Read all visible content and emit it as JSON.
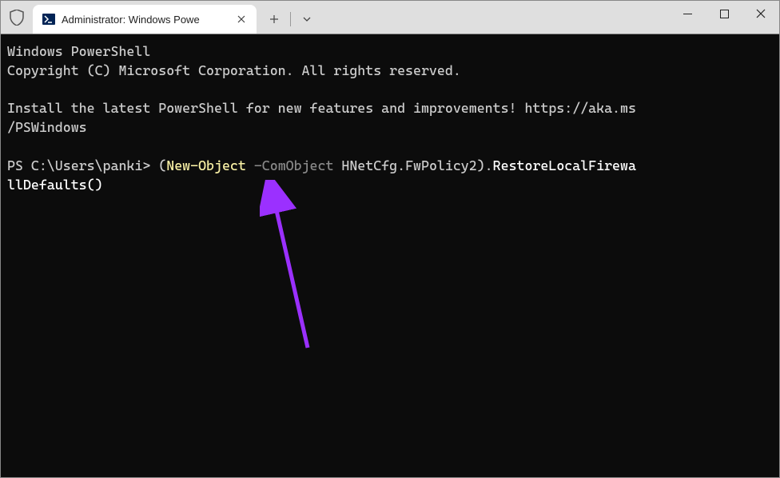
{
  "window": {
    "tab_title": "Administrator: Windows Powe"
  },
  "terminal": {
    "line1": "Windows PowerShell",
    "line2": "Copyright (C) Microsoft Corporation. All rights reserved.",
    "line3_a": "Install the latest PowerShell for new features and improvements! https://aka.ms",
    "line3_b": "/PSWindows",
    "prompt": "PS C:\\Users\\panki> ",
    "cmd_paren_open": "(",
    "cmd_cmdlet": "New-Object",
    "cmd_space": " ",
    "cmd_param": "-ComObject",
    "cmd_arg": " HNetCfg.FwPolicy2",
    "cmd_paren_close": ").",
    "cmd_method_a": "RestoreLocalFirewa",
    "cmd_method_b": "llDefaults()"
  }
}
